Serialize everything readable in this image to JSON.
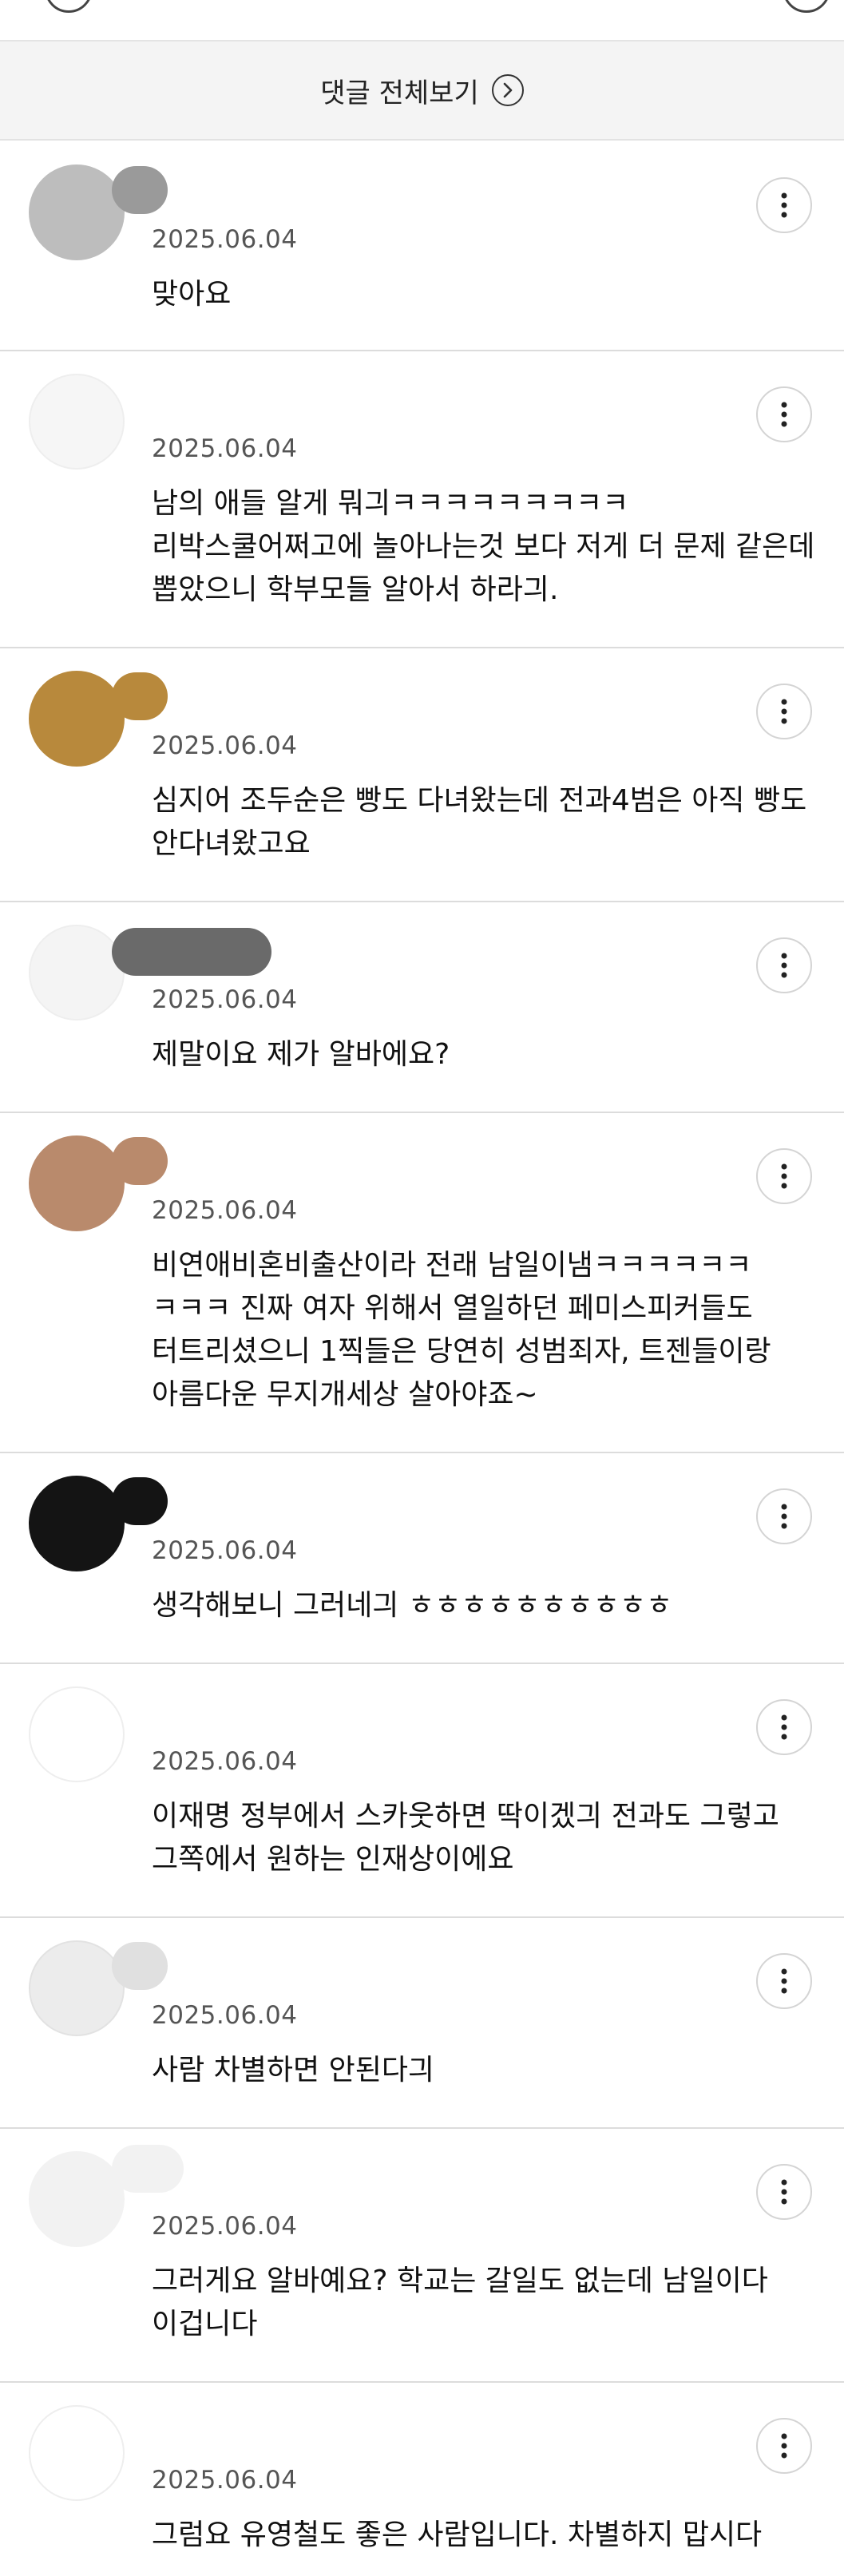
{
  "header": {
    "view_all_label": "댓글 전체보기"
  },
  "comments": [
    {
      "date": "2025.06.04",
      "text": "맞아요"
    },
    {
      "date": "2025.06.04",
      "text": "남의 애들 알게 뭐긔ㅋㅋㅋㅋㅋㅋㅋㅋㅋ 리박스쿨어쩌고에 놀아나는것 보다 저게 더 문제 같은데 뽑았으니 학부모들 알아서 하라긔."
    },
    {
      "date": "2025.06.04",
      "text": "심지어 조두순은 빵도 다녀왔는데 전과4범은 아직 빵도 안다녀왔고요"
    },
    {
      "date": "2025.06.04",
      "text": "제말이요 제가 알바에요?"
    },
    {
      "date": "2025.06.04",
      "text": "비연애비혼비출산이라 전래 남일이냄ㅋㅋㅋㅋㅋㅋ ㅋㅋㅋ 진짜 여자 위해서 열일하던 페미스피커들도 터트리셨으니 1찍들은 당연히 성범죄자, 트젠들이랑 아름다운 무지개세상 살아야죠~"
    },
    {
      "date": "2025.06.04",
      "text": "생각해보니 그러네긔 ㅎㅎㅎㅎㅎㅎㅎㅎㅎㅎ"
    },
    {
      "date": "2025.06.04",
      "text": "이재명 정부에서 스카웃하면 딱이겠긔 전과도 그렇고 그쪽에서 원하는 인재상이에요"
    },
    {
      "date": "2025.06.04",
      "text": "사람 차별하면 안된다긔"
    },
    {
      "date": "2025.06.04",
      "text": "그러게요 알바예요? 학교는 갈일도 없는데 남일이다 이겁니다"
    },
    {
      "date": "2025.06.04",
      "text": "그럼요 유영철도 좋은 사람입니다. 차별하지 맙시다"
    }
  ]
}
